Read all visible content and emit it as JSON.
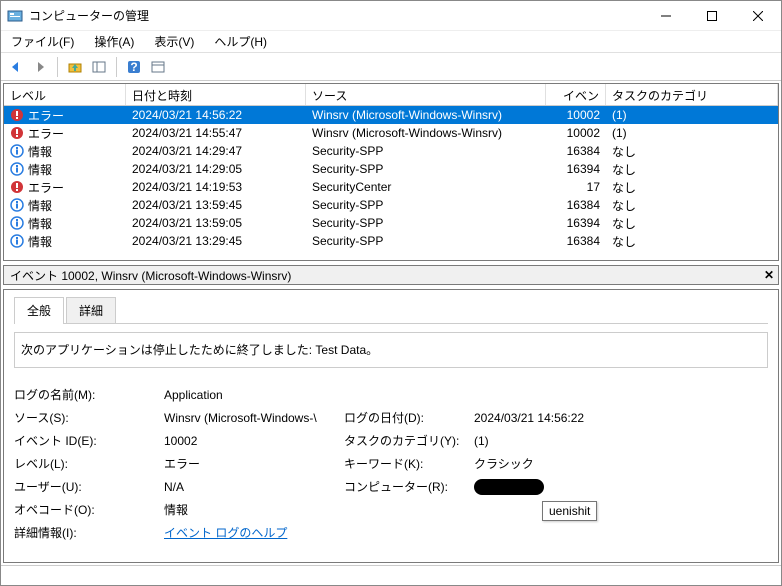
{
  "window": {
    "title": "コンピューターの管理"
  },
  "menu": {
    "file": "ファイル(F)",
    "action": "操作(A)",
    "view": "表示(V)",
    "help": "ヘルプ(H)"
  },
  "columns": {
    "level": "レベル",
    "date": "日付と時刻",
    "source": "ソース",
    "id": "イベント ID",
    "cat": "タスクのカテゴリ"
  },
  "events": [
    {
      "level": "エラー",
      "levelType": "error",
      "date": "2024/03/21 14:56:22",
      "source": "Winsrv (Microsoft-Windows-Winsrv)",
      "id": "10002",
      "cat": "(1)",
      "selected": true
    },
    {
      "level": "エラー",
      "levelType": "error",
      "date": "2024/03/21 14:55:47",
      "source": "Winsrv (Microsoft-Windows-Winsrv)",
      "id": "10002",
      "cat": "(1)"
    },
    {
      "level": "情報",
      "levelType": "info",
      "date": "2024/03/21 14:29:47",
      "source": "Security-SPP",
      "id": "16384",
      "cat": "なし"
    },
    {
      "level": "情報",
      "levelType": "info",
      "date": "2024/03/21 14:29:05",
      "source": "Security-SPP",
      "id": "16394",
      "cat": "なし"
    },
    {
      "level": "エラー",
      "levelType": "error",
      "date": "2024/03/21 14:19:53",
      "source": "SecurityCenter",
      "id": "17",
      "cat": "なし"
    },
    {
      "level": "情報",
      "levelType": "info",
      "date": "2024/03/21 13:59:45",
      "source": "Security-SPP",
      "id": "16384",
      "cat": "なし"
    },
    {
      "level": "情報",
      "levelType": "info",
      "date": "2024/03/21 13:59:05",
      "source": "Security-SPP",
      "id": "16394",
      "cat": "なし"
    },
    {
      "level": "情報",
      "levelType": "info",
      "date": "2024/03/21 13:29:45",
      "source": "Security-SPP",
      "id": "16384",
      "cat": "なし"
    }
  ],
  "detailHeader": "イベント 10002, Winsrv (Microsoft-Windows-Winsrv)",
  "tabs": {
    "general": "全般",
    "details": "詳細"
  },
  "description": "次のアプリケーションは停止したために終了しました: Test Data。",
  "props": {
    "logNameLabel": "ログの名前(M):",
    "logName": "Application",
    "sourceLabel": "ソース(S):",
    "source": "Winsrv (Microsoft-Windows-\\",
    "dateLabel": "ログの日付(D):",
    "date": "2024/03/21 14:56:22",
    "eventIdLabel": "イベント ID(E):",
    "eventId": "10002",
    "taskCatLabel": "タスクのカテゴリ(Y):",
    "taskCat": "(1)",
    "levelLabel": "レベル(L):",
    "level": "エラー",
    "keywordsLabel": "キーワード(K):",
    "keywords": "クラシック",
    "userLabel": "ユーザー(U):",
    "user": "N/A",
    "computerLabel": "コンピューター(R):",
    "opcodeLabel": "オペコード(O):",
    "opcode": "情報",
    "moreInfoLabel": "詳細情報(I):",
    "moreInfoLink": "イベント ログのヘルプ"
  },
  "tooltip": "uenishit"
}
